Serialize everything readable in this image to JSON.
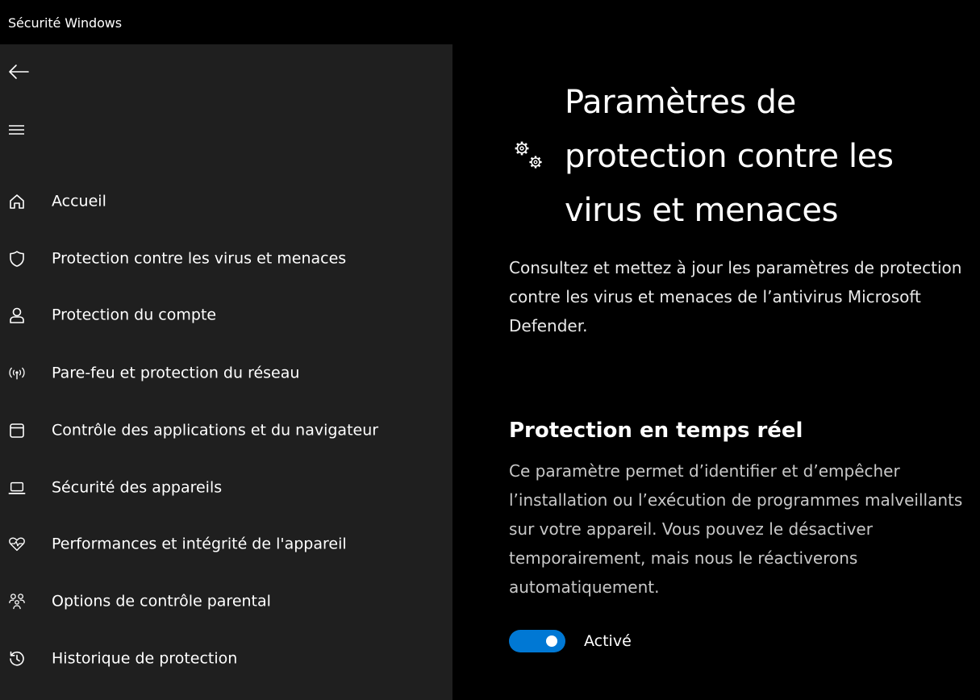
{
  "window": {
    "title": "Sécurité Windows"
  },
  "sidebar": {
    "back_icon": "back-arrow-icon",
    "menu_icon": "hamburger-menu-icon",
    "items": [
      {
        "label": "Accueil",
        "icon": "home-icon"
      },
      {
        "label": "Protection contre les virus et menaces",
        "icon": "shield-icon"
      },
      {
        "label": "Protection du compte",
        "icon": "person-icon"
      },
      {
        "label": "Pare-feu et protection du réseau",
        "icon": "wifi-signal-icon"
      },
      {
        "label": "Contrôle des applications et du navigateur",
        "icon": "browser-window-icon"
      },
      {
        "label": "Sécurité des appareils",
        "icon": "laptop-icon"
      },
      {
        "label": "Performances et intégrité de l'appareil",
        "icon": "heart-pulse-icon"
      },
      {
        "label": "Options de contrôle parental",
        "icon": "family-icon"
      },
      {
        "label": "Historique de protection",
        "icon": "history-icon"
      }
    ]
  },
  "main": {
    "page_icon": "gears-icon",
    "title": "Paramètres de protection contre les virus et menaces",
    "description": "Consultez et mettez à jour les paramètres de protection contre les virus et menaces de l’antivirus Microsoft Defender.",
    "realtime": {
      "title": "Protection en temps réel",
      "description": "Ce paramètre permet d’identifier et d’empêcher l’installation ou l’exécution de programmes malveillants sur votre appareil. Vous pouvez le désactiver temporairement, mais nous le réactiverons automatiquement.",
      "toggle_state": "on",
      "toggle_label": "Activé"
    }
  },
  "colors": {
    "accent": "#0078d4",
    "sidebar_bg": "#1f1f1f",
    "main_bg": "#000000"
  }
}
